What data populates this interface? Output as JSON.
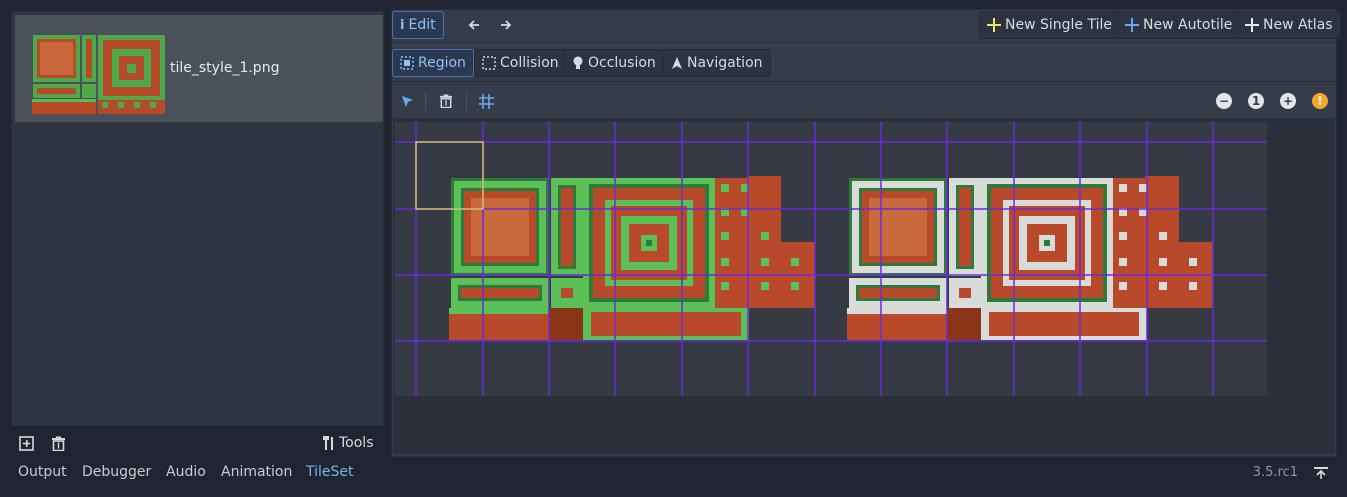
{
  "texture_list": {
    "items": [
      {
        "name": "tile_style_1.png"
      }
    ]
  },
  "left_toolbar": {
    "add_icon": "add-texture-icon",
    "remove_icon": "trash-icon",
    "tools_label": "Tools"
  },
  "top_toolbar": {
    "edit_label": "Edit",
    "new_single_tile": "New Single Tile",
    "new_autotile": "New Autotile",
    "new_atlas": "New Atlas"
  },
  "mode_tabs": [
    {
      "label": "Region",
      "active": true
    },
    {
      "label": "Collision",
      "active": false
    },
    {
      "label": "Occlusion",
      "active": false
    },
    {
      "label": "Navigation",
      "active": false
    }
  ],
  "zoom_controls": {
    "reset_label": "1"
  },
  "bottom_tabs": [
    {
      "label": "Output",
      "active": false
    },
    {
      "label": "Debugger",
      "active": false
    },
    {
      "label": "Audio",
      "active": false
    },
    {
      "label": "Animation",
      "active": false
    },
    {
      "label": "TileSet",
      "active": true
    }
  ],
  "version": "3.5.rc1",
  "colors": {
    "accent": "#73b5f0",
    "grid_line": "#6a2bd9",
    "selection": "#f2e460",
    "add_icon": "#f2e460",
    "autotile_icon": "#69a7f0",
    "warning": "#f5a52a"
  }
}
